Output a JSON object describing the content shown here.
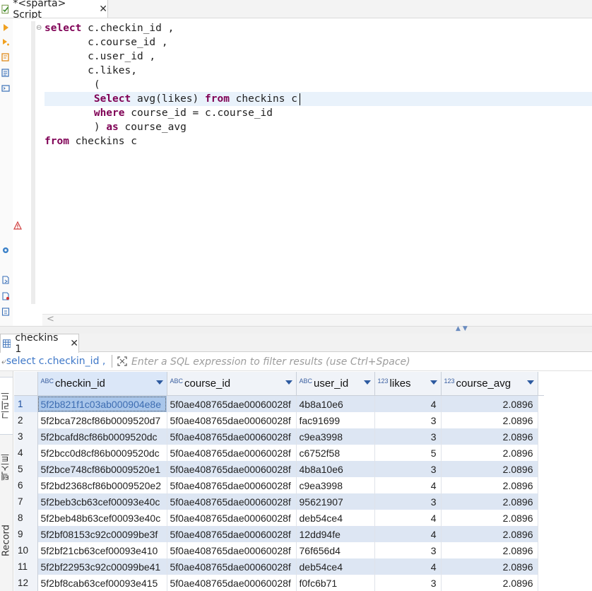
{
  "editor_tab": {
    "title": "*<sparta> Script",
    "close": "✕"
  },
  "editor": {
    "lines": [
      {
        "parts": [
          {
            "t": "select",
            "k": 1
          },
          {
            "t": " c.checkin_id ,"
          }
        ]
      },
      {
        "parts": [
          {
            "t": "       c.course_id ,"
          }
        ]
      },
      {
        "parts": [
          {
            "t": "       c.user_id ,"
          }
        ]
      },
      {
        "parts": [
          {
            "t": "       c.likes,"
          }
        ]
      },
      {
        "parts": [
          {
            "t": "        ("
          }
        ]
      },
      {
        "parts": [
          {
            "t": "        "
          },
          {
            "t": "Select",
            "k": 1
          },
          {
            "t": " avg(likes) "
          },
          {
            "t": "from",
            "k": 1
          },
          {
            "t": " checkins c"
          }
        ]
      },
      {
        "parts": [
          {
            "t": "        "
          },
          {
            "t": "where",
            "k": 1
          },
          {
            "t": " course_id = c.course_id"
          }
        ]
      },
      {
        "parts": [
          {
            "t": "        ) "
          },
          {
            "t": "as",
            "k": 1
          },
          {
            "t": " course_avg"
          }
        ]
      },
      {
        "parts": [
          {
            "t": "from",
            "k": 1
          },
          {
            "t": " checkins c"
          }
        ]
      }
    ]
  },
  "results_tab": {
    "title": "checkins 1",
    "close": "✕"
  },
  "filter": {
    "query_label": "select c.checkin_id ,",
    "placeholder": "Enter a SQL expression to filter results (use Ctrl+Space)"
  },
  "side_tabs": [
    "그리드",
    "텍스트",
    "Record"
  ],
  "grid": {
    "columns": [
      {
        "type": "ABC",
        "name": "checkin_id"
      },
      {
        "type": "ABC",
        "name": "course_id"
      },
      {
        "type": "ABC",
        "name": "user_id"
      },
      {
        "type": "123",
        "name": "likes"
      },
      {
        "type": "123",
        "name": "course_avg"
      }
    ],
    "rows": [
      {
        "n": "1",
        "checkin_id": "5f2b821f1c03ab000904e8e",
        "course_id": "5f0ae408765dae00060028f",
        "user_id": "4b8a10e6",
        "likes": "4",
        "course_avg": "2.0896"
      },
      {
        "n": "2",
        "checkin_id": "5f2bca728cf86b0009520d7",
        "course_id": "5f0ae408765dae00060028f",
        "user_id": "fac91699",
        "likes": "3",
        "course_avg": "2.0896"
      },
      {
        "n": "3",
        "checkin_id": "5f2bcafd8cf86b0009520dc",
        "course_id": "5f0ae408765dae00060028f",
        "user_id": "c9ea3998",
        "likes": "3",
        "course_avg": "2.0896"
      },
      {
        "n": "4",
        "checkin_id": "5f2bcc0d8cf86b0009520dc",
        "course_id": "5f0ae408765dae00060028f",
        "user_id": "c6752f58",
        "likes": "5",
        "course_avg": "2.0896"
      },
      {
        "n": "5",
        "checkin_id": "5f2bce748cf86b0009520e1",
        "course_id": "5f0ae408765dae00060028f",
        "user_id": "4b8a10e6",
        "likes": "3",
        "course_avg": "2.0896"
      },
      {
        "n": "6",
        "checkin_id": "5f2bd2368cf86b0009520e2",
        "course_id": "5f0ae408765dae00060028f",
        "user_id": "c9ea3998",
        "likes": "4",
        "course_avg": "2.0896"
      },
      {
        "n": "7",
        "checkin_id": "5f2beb3cb63cef00093e40c",
        "course_id": "5f0ae408765dae00060028f",
        "user_id": "95621907",
        "likes": "3",
        "course_avg": "2.0896"
      },
      {
        "n": "8",
        "checkin_id": "5f2beb48b63cef00093e40c",
        "course_id": "5f0ae408765dae00060028f",
        "user_id": "deb54ce4",
        "likes": "4",
        "course_avg": "2.0896"
      },
      {
        "n": "9",
        "checkin_id": "5f2bf08153c92c00099be3f",
        "course_id": "5f0ae408765dae00060028f",
        "user_id": "12dd94fe",
        "likes": "4",
        "course_avg": "2.0896"
      },
      {
        "n": "10",
        "checkin_id": "5f2bf21cb63cef00093e410",
        "course_id": "5f0ae408765dae00060028f",
        "user_id": "76f656d4",
        "likes": "3",
        "course_avg": "2.0896"
      },
      {
        "n": "11",
        "checkin_id": "5f2bf22953c92c00099be41",
        "course_id": "5f0ae408765dae00060028f",
        "user_id": "deb54ce4",
        "likes": "4",
        "course_avg": "2.0896"
      },
      {
        "n": "12",
        "checkin_id": "5f2bf8cab63cef00093e415",
        "course_id": "5f0ae408765dae00060028f",
        "user_id": "f0fc6b71",
        "likes": "3",
        "course_avg": "2.0896"
      }
    ]
  },
  "icons": {
    "editor_tab": "sql-script-icon",
    "toolbar": [
      "execute-statement-icon",
      "execute-script-icon",
      "explain-plan-icon",
      "load-file-icon",
      "open-console-icon",
      "settings-icon",
      "save-file-icon",
      "export-file-icon",
      "import-file-icon"
    ],
    "warning": "warning-icon",
    "results_tab": "table-grid-icon",
    "filter": "filter-expand-icon"
  },
  "colors": {
    "keyword": "#7f0055",
    "filter_query": "#3f78c8",
    "row_stripe": "#dde6f3",
    "selected_cell": "#a9c6ea"
  }
}
